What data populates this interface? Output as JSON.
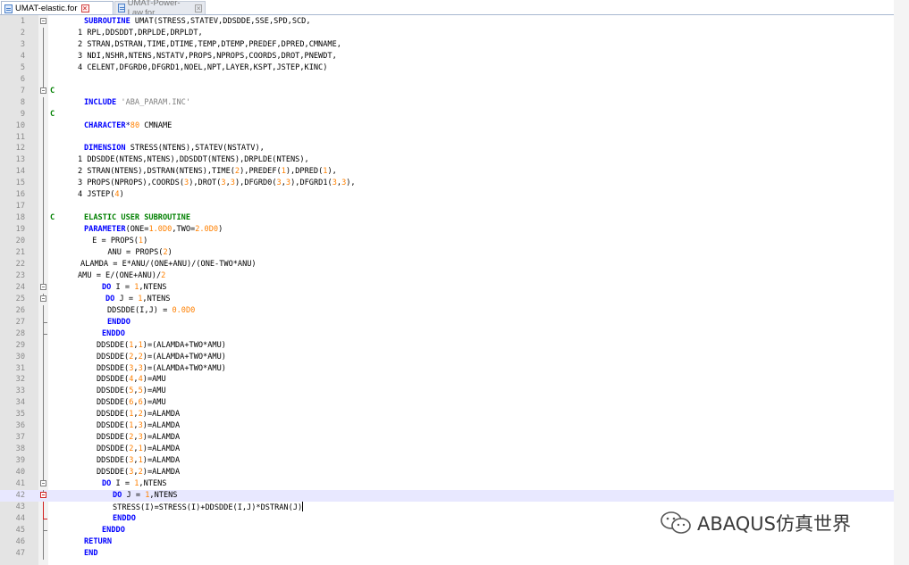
{
  "tabs": [
    {
      "label": "UMAT-elastic.for",
      "active": true
    },
    {
      "label": "UMAT-Power-Law.for",
      "active": false
    }
  ],
  "current_line": 42,
  "lines": [
    {
      "n": "1",
      "fold": "open",
      "tokens": [
        [
          "kw",
          "SUBROUTINE "
        ],
        [
          "pl",
          "UMAT(STRESS,STATEV,DDSDDE,SSE,SPD,SCD,"
        ]
      ]
    },
    {
      "n": "2",
      "tokens": [
        [
          "pl",
          "1 RPL,DDSDDT,DRPLDE,DRPLDT,"
        ]
      ]
    },
    {
      "n": "3",
      "tokens": [
        [
          "pl",
          "2 STRAN,DSTRAN,TIME,DTIME,TEMP,DTEMP,PREDEF,DPRED,CMNAME,"
        ]
      ]
    },
    {
      "n": "4",
      "tokens": [
        [
          "pl",
          "3 NDI,NSHR,NTENS,NSTATV,PROPS,NPROPS,COORDS,DROT,PNEWDT,"
        ]
      ]
    },
    {
      "n": "5",
      "tokens": [
        [
          "pl",
          "4 CELENT,DFGRD0,DFGRD1,NOEL,NPT,LAYER,KSPT,JSTEP,KINC)"
        ]
      ]
    },
    {
      "n": "6",
      "tokens": []
    },
    {
      "n": "7",
      "c": "C",
      "fold": "open2",
      "tokens": []
    },
    {
      "n": "8",
      "tokens": [
        [
          "kw",
          "INCLUDE "
        ],
        [
          "str",
          "'ABA_PARAM.INC'"
        ]
      ]
    },
    {
      "n": "9",
      "c": "C",
      "tokens": []
    },
    {
      "n": "10",
      "tokens": [
        [
          "kw",
          "CHARACTER"
        ],
        [
          "op",
          "*"
        ],
        [
          "num",
          "80"
        ],
        [
          "pl",
          " CMNAME"
        ]
      ]
    },
    {
      "n": "11",
      "tokens": []
    },
    {
      "n": "12",
      "tokens": [
        [
          "kw",
          "DIMENSION "
        ],
        [
          "pl",
          "STRESS(NTENS),STATEV(NSTATV),"
        ]
      ]
    },
    {
      "n": "13",
      "tokens": [
        [
          "pl",
          "1 DDSDDE(NTENS,NTENS),DDSDDT(NTENS),DRPLDE(NTENS),"
        ]
      ]
    },
    {
      "n": "14",
      "tokens": [
        [
          "pl",
          "2 STRAN(NTENS),DSTRAN(NTENS),TIME("
        ],
        [
          "num",
          "2"
        ],
        [
          "pl",
          "),PREDEF("
        ],
        [
          "num",
          "1"
        ],
        [
          "pl",
          "),DPRED("
        ],
        [
          "num",
          "1"
        ],
        [
          "pl",
          "),"
        ]
      ]
    },
    {
      "n": "15",
      "tokens": [
        [
          "pl",
          "3 PROPS(NPROPS),COORDS("
        ],
        [
          "num",
          "3"
        ],
        [
          "pl",
          "),DROT("
        ],
        [
          "num",
          "3"
        ],
        [
          "pl",
          ","
        ],
        [
          "num",
          "3"
        ],
        [
          "pl",
          "),DFGRD0("
        ],
        [
          "num",
          "3"
        ],
        [
          "pl",
          ","
        ],
        [
          "num",
          "3"
        ],
        [
          "pl",
          "),DFGRD1("
        ],
        [
          "num",
          "3"
        ],
        [
          "pl",
          ","
        ],
        [
          "num",
          "3"
        ],
        [
          "pl",
          "),"
        ]
      ]
    },
    {
      "n": "16",
      "tokens": [
        [
          "pl",
          "4 JSTEP("
        ],
        [
          "num",
          "4"
        ],
        [
          "pl",
          ")"
        ]
      ]
    },
    {
      "n": "17",
      "tokens": []
    },
    {
      "n": "18",
      "c": "C",
      "tokens": [
        [
          "cm",
          "ELASTIC USER SUBROUTINE"
        ]
      ]
    },
    {
      "n": "19",
      "tokens": [
        [
          "kw",
          "PARAMETER"
        ],
        [
          "pl",
          "(ONE="
        ],
        [
          "num",
          "1.0D0"
        ],
        [
          "pl",
          ",TWO="
        ],
        [
          "num",
          "2.0D0"
        ],
        [
          "pl",
          ")"
        ]
      ]
    },
    {
      "n": "20",
      "tokens": [
        [
          "pl",
          " E = PROPS("
        ],
        [
          "num",
          "1"
        ],
        [
          "pl",
          ")"
        ]
      ]
    },
    {
      "n": "21",
      "tokens": [
        [
          "pl",
          "  ANU = PROPS("
        ],
        [
          "num",
          "2"
        ],
        [
          "pl",
          ")"
        ]
      ]
    },
    {
      "n": "22",
      "tokens": [
        [
          "pl",
          "ALAMDA = E*ANU/(ONE+ANU)/(ONE-TWO*ANU)"
        ]
      ]
    },
    {
      "n": "23",
      "tokens": [
        [
          "pl",
          "AMU = E/(ONE+ANU)/"
        ],
        [
          "num",
          "2"
        ]
      ]
    },
    {
      "n": "24",
      "fold": "open",
      "tokens": [
        [
          "kw",
          "DO "
        ],
        [
          "pl",
          "I = "
        ],
        [
          "num",
          "1"
        ],
        [
          "pl",
          ",NTENS"
        ]
      ]
    },
    {
      "n": "25",
      "fold": "open",
      "tokens": [
        [
          "kw",
          "DO "
        ],
        [
          "pl",
          "J = "
        ],
        [
          "num",
          "1"
        ],
        [
          "pl",
          ",NTENS"
        ]
      ]
    },
    {
      "n": "26",
      "tokens": [
        [
          "pl",
          "DDSDDE(I,J) = "
        ],
        [
          "num",
          "0.0D0"
        ]
      ]
    },
    {
      "n": "27",
      "fold": "end",
      "tokens": [
        [
          "kw",
          "ENDDO"
        ]
      ]
    },
    {
      "n": "28",
      "fold": "end",
      "tokens": [
        [
          "kw",
          "ENDDO"
        ]
      ]
    },
    {
      "n": "29",
      "tokens": [
        [
          "pl",
          "DDSDDE("
        ],
        [
          "num",
          "1"
        ],
        [
          "pl",
          ","
        ],
        [
          "num",
          "1"
        ],
        [
          "pl",
          ")=(ALAMDA+TWO*AMU)"
        ]
      ]
    },
    {
      "n": "30",
      "tokens": [
        [
          "pl",
          "DDSDDE("
        ],
        [
          "num",
          "2"
        ],
        [
          "pl",
          ","
        ],
        [
          "num",
          "2"
        ],
        [
          "pl",
          ")=(ALAMDA+TWO*AMU)"
        ]
      ]
    },
    {
      "n": "31",
      "tokens": [
        [
          "pl",
          "DDSDDE("
        ],
        [
          "num",
          "3"
        ],
        [
          "pl",
          ","
        ],
        [
          "num",
          "3"
        ],
        [
          "pl",
          ")=(ALAMDA+TWO*AMU)"
        ]
      ]
    },
    {
      "n": "32",
      "tokens": [
        [
          "pl",
          "DDSDDE("
        ],
        [
          "num",
          "4"
        ],
        [
          "pl",
          ","
        ],
        [
          "num",
          "4"
        ],
        [
          "pl",
          ")=AMU"
        ]
      ]
    },
    {
      "n": "33",
      "tokens": [
        [
          "pl",
          "DDSDDE("
        ],
        [
          "num",
          "5"
        ],
        [
          "pl",
          ","
        ],
        [
          "num",
          "5"
        ],
        [
          "pl",
          ")=AMU"
        ]
      ]
    },
    {
      "n": "34",
      "tokens": [
        [
          "pl",
          "DDSDDE("
        ],
        [
          "num",
          "6"
        ],
        [
          "pl",
          ","
        ],
        [
          "num",
          "6"
        ],
        [
          "pl",
          ")=AMU"
        ]
      ]
    },
    {
      "n": "35",
      "tokens": [
        [
          "pl",
          "DDSDDE("
        ],
        [
          "num",
          "1"
        ],
        [
          "pl",
          ","
        ],
        [
          "num",
          "2"
        ],
        [
          "pl",
          ")=ALAMDA"
        ]
      ]
    },
    {
      "n": "36",
      "tokens": [
        [
          "pl",
          "DDSDDE("
        ],
        [
          "num",
          "1"
        ],
        [
          "pl",
          ","
        ],
        [
          "num",
          "3"
        ],
        [
          "pl",
          ")=ALAMDA"
        ]
      ]
    },
    {
      "n": "37",
      "tokens": [
        [
          "pl",
          "DDSDDE("
        ],
        [
          "num",
          "2"
        ],
        [
          "pl",
          ","
        ],
        [
          "num",
          "3"
        ],
        [
          "pl",
          ")=ALAMDA"
        ]
      ]
    },
    {
      "n": "38",
      "tokens": [
        [
          "pl",
          "DDSDDE("
        ],
        [
          "num",
          "2"
        ],
        [
          "pl",
          ","
        ],
        [
          "num",
          "1"
        ],
        [
          "pl",
          ")=ALAMDA"
        ]
      ]
    },
    {
      "n": "39",
      "tokens": [
        [
          "pl",
          "DDSDDE("
        ],
        [
          "num",
          "3"
        ],
        [
          "pl",
          ","
        ],
        [
          "num",
          "1"
        ],
        [
          "pl",
          ")=ALAMDA"
        ]
      ]
    },
    {
      "n": "40",
      "tokens": [
        [
          "pl",
          "DDSDDE("
        ],
        [
          "num",
          "3"
        ],
        [
          "pl",
          ","
        ],
        [
          "num",
          "2"
        ],
        [
          "pl",
          ")=ALAMDA"
        ]
      ]
    },
    {
      "n": "41",
      "fold": "open",
      "tokens": [
        [
          "kw",
          "DO "
        ],
        [
          "pl",
          "I = "
        ],
        [
          "num",
          "1"
        ],
        [
          "pl",
          ",NTENS"
        ]
      ]
    },
    {
      "n": "42",
      "fold": "openred",
      "tokens": [
        [
          "kw",
          "DO "
        ],
        [
          "pl",
          "J = "
        ],
        [
          "num",
          "1"
        ],
        [
          "pl",
          ",NTENS"
        ]
      ]
    },
    {
      "n": "43",
      "tokens": [
        [
          "pl",
          "STRESS(I)=STRESS(I)+DDSDDE(I,J)*DSTRAN(J)"
        ]
      ],
      "caret": true
    },
    {
      "n": "44",
      "fold": "endred",
      "tokens": [
        [
          "kw",
          "ENDDO"
        ]
      ]
    },
    {
      "n": "45",
      "fold": "end",
      "tokens": [
        [
          "kw",
          "ENDDO"
        ]
      ]
    },
    {
      "n": "46",
      "tokens": [
        [
          "kw",
          "RETURN"
        ]
      ]
    },
    {
      "n": "47",
      "tokens": [
        [
          "kw",
          "END"
        ]
      ]
    }
  ],
  "watermark": {
    "text": "ABAQUS仿真世界",
    "icon": "wechat-official-account-icon"
  }
}
